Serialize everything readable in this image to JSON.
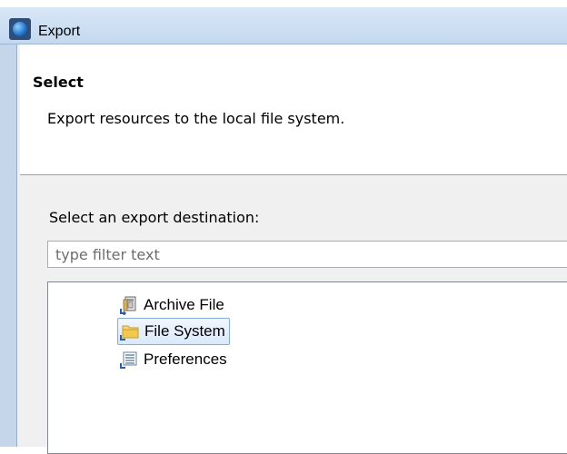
{
  "window": {
    "title": "Export"
  },
  "header": {
    "title": "Select",
    "description": "Export resources to the local file system."
  },
  "body": {
    "destination_label": "Select an export destination:",
    "filter_placeholder": "type filter text",
    "filter_value": ""
  },
  "tree": {
    "items": [
      {
        "label": "Archive File",
        "icon": "archive-file-icon",
        "selected": false
      },
      {
        "label": "File System",
        "icon": "folder-icon",
        "selected": true
      },
      {
        "label": "Preferences",
        "icon": "preferences-icon",
        "selected": false
      }
    ]
  },
  "colors": {
    "selection_border": "#84acdd",
    "titlebar": "#c3d8f0",
    "folder": "#f2c94c"
  }
}
